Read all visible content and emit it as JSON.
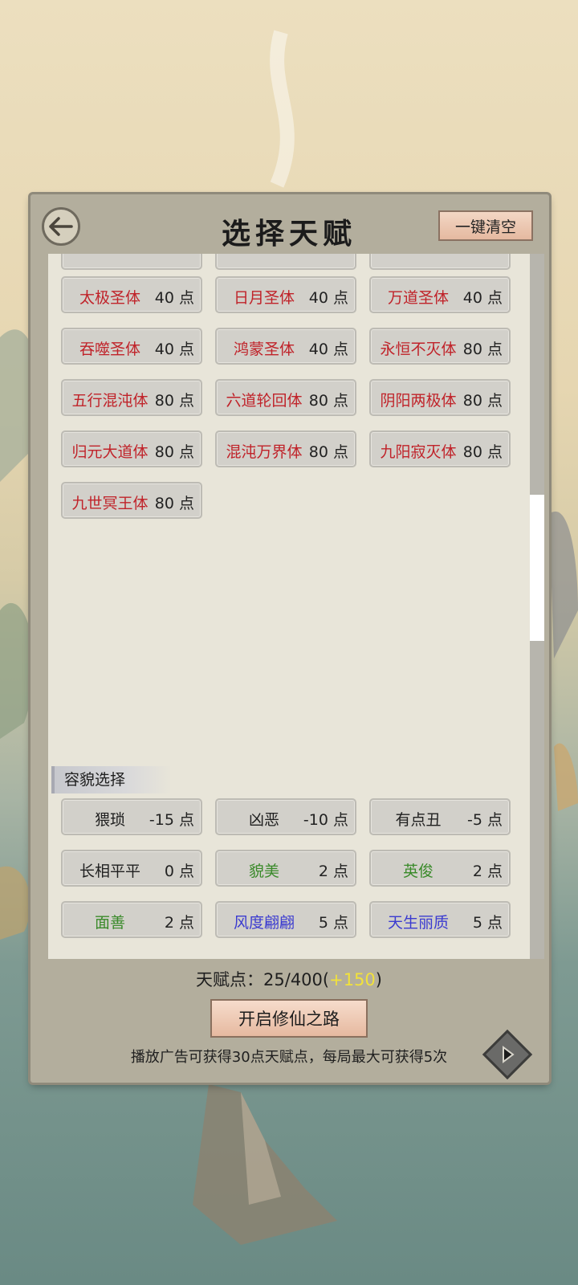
{
  "header": {
    "title": "选择天赋",
    "back_icon": "back-arrow-icon",
    "clear_label": "一键清空"
  },
  "talents": [
    {
      "name": "太极圣体",
      "cost": "40 点"
    },
    {
      "name": "日月圣体",
      "cost": "40 点"
    },
    {
      "name": "万道圣体",
      "cost": "40 点"
    },
    {
      "name": "吞噬圣体",
      "cost": "40 点"
    },
    {
      "name": "鸿蒙圣体",
      "cost": "40 点"
    },
    {
      "name": "永恒不灭体",
      "cost": "80 点"
    },
    {
      "name": "五行混沌体",
      "cost": "80 点"
    },
    {
      "name": "六道轮回体",
      "cost": "80 点"
    },
    {
      "name": "阴阳两极体",
      "cost": "80 点"
    },
    {
      "name": "归元大道体",
      "cost": "80 点"
    },
    {
      "name": "混沌万界体",
      "cost": "80 点"
    },
    {
      "name": "九阳寂灭体",
      "cost": "80 点"
    },
    {
      "name": "九世冥王体",
      "cost": "80 点"
    }
  ],
  "appearance": {
    "title": "容貌选择",
    "items": [
      {
        "name": "猥琐",
        "cost": "-15 点",
        "color": "black"
      },
      {
        "name": "凶恶",
        "cost": "-10 点",
        "color": "black"
      },
      {
        "name": "有点丑",
        "cost": "-5 点",
        "color": "black"
      },
      {
        "name": "长相平平",
        "cost": "0 点",
        "color": "black"
      },
      {
        "name": "貌美",
        "cost": "2 点",
        "color": "green"
      },
      {
        "name": "英俊",
        "cost": "2 点",
        "color": "green"
      },
      {
        "name": "面善",
        "cost": "2 点",
        "color": "green"
      },
      {
        "name": "风度翩翩",
        "cost": "5 点",
        "color": "blue"
      },
      {
        "name": "天生丽质",
        "cost": "5 点",
        "color": "blue"
      }
    ]
  },
  "footer": {
    "points_label": "天赋点：",
    "points_value": "25/400(",
    "points_bonus": "+150",
    "points_close": ")",
    "start_label": "开启修仙之路",
    "ad_note": "播放广告可获得30点天赋点，每局最大可获得5次",
    "ad_icon": "play-ad-icon"
  },
  "colors": {
    "talent_red": "#c0232a",
    "green": "#3a8a2a",
    "blue": "#3b3bd0",
    "bonus_yellow": "#f2e23a"
  }
}
